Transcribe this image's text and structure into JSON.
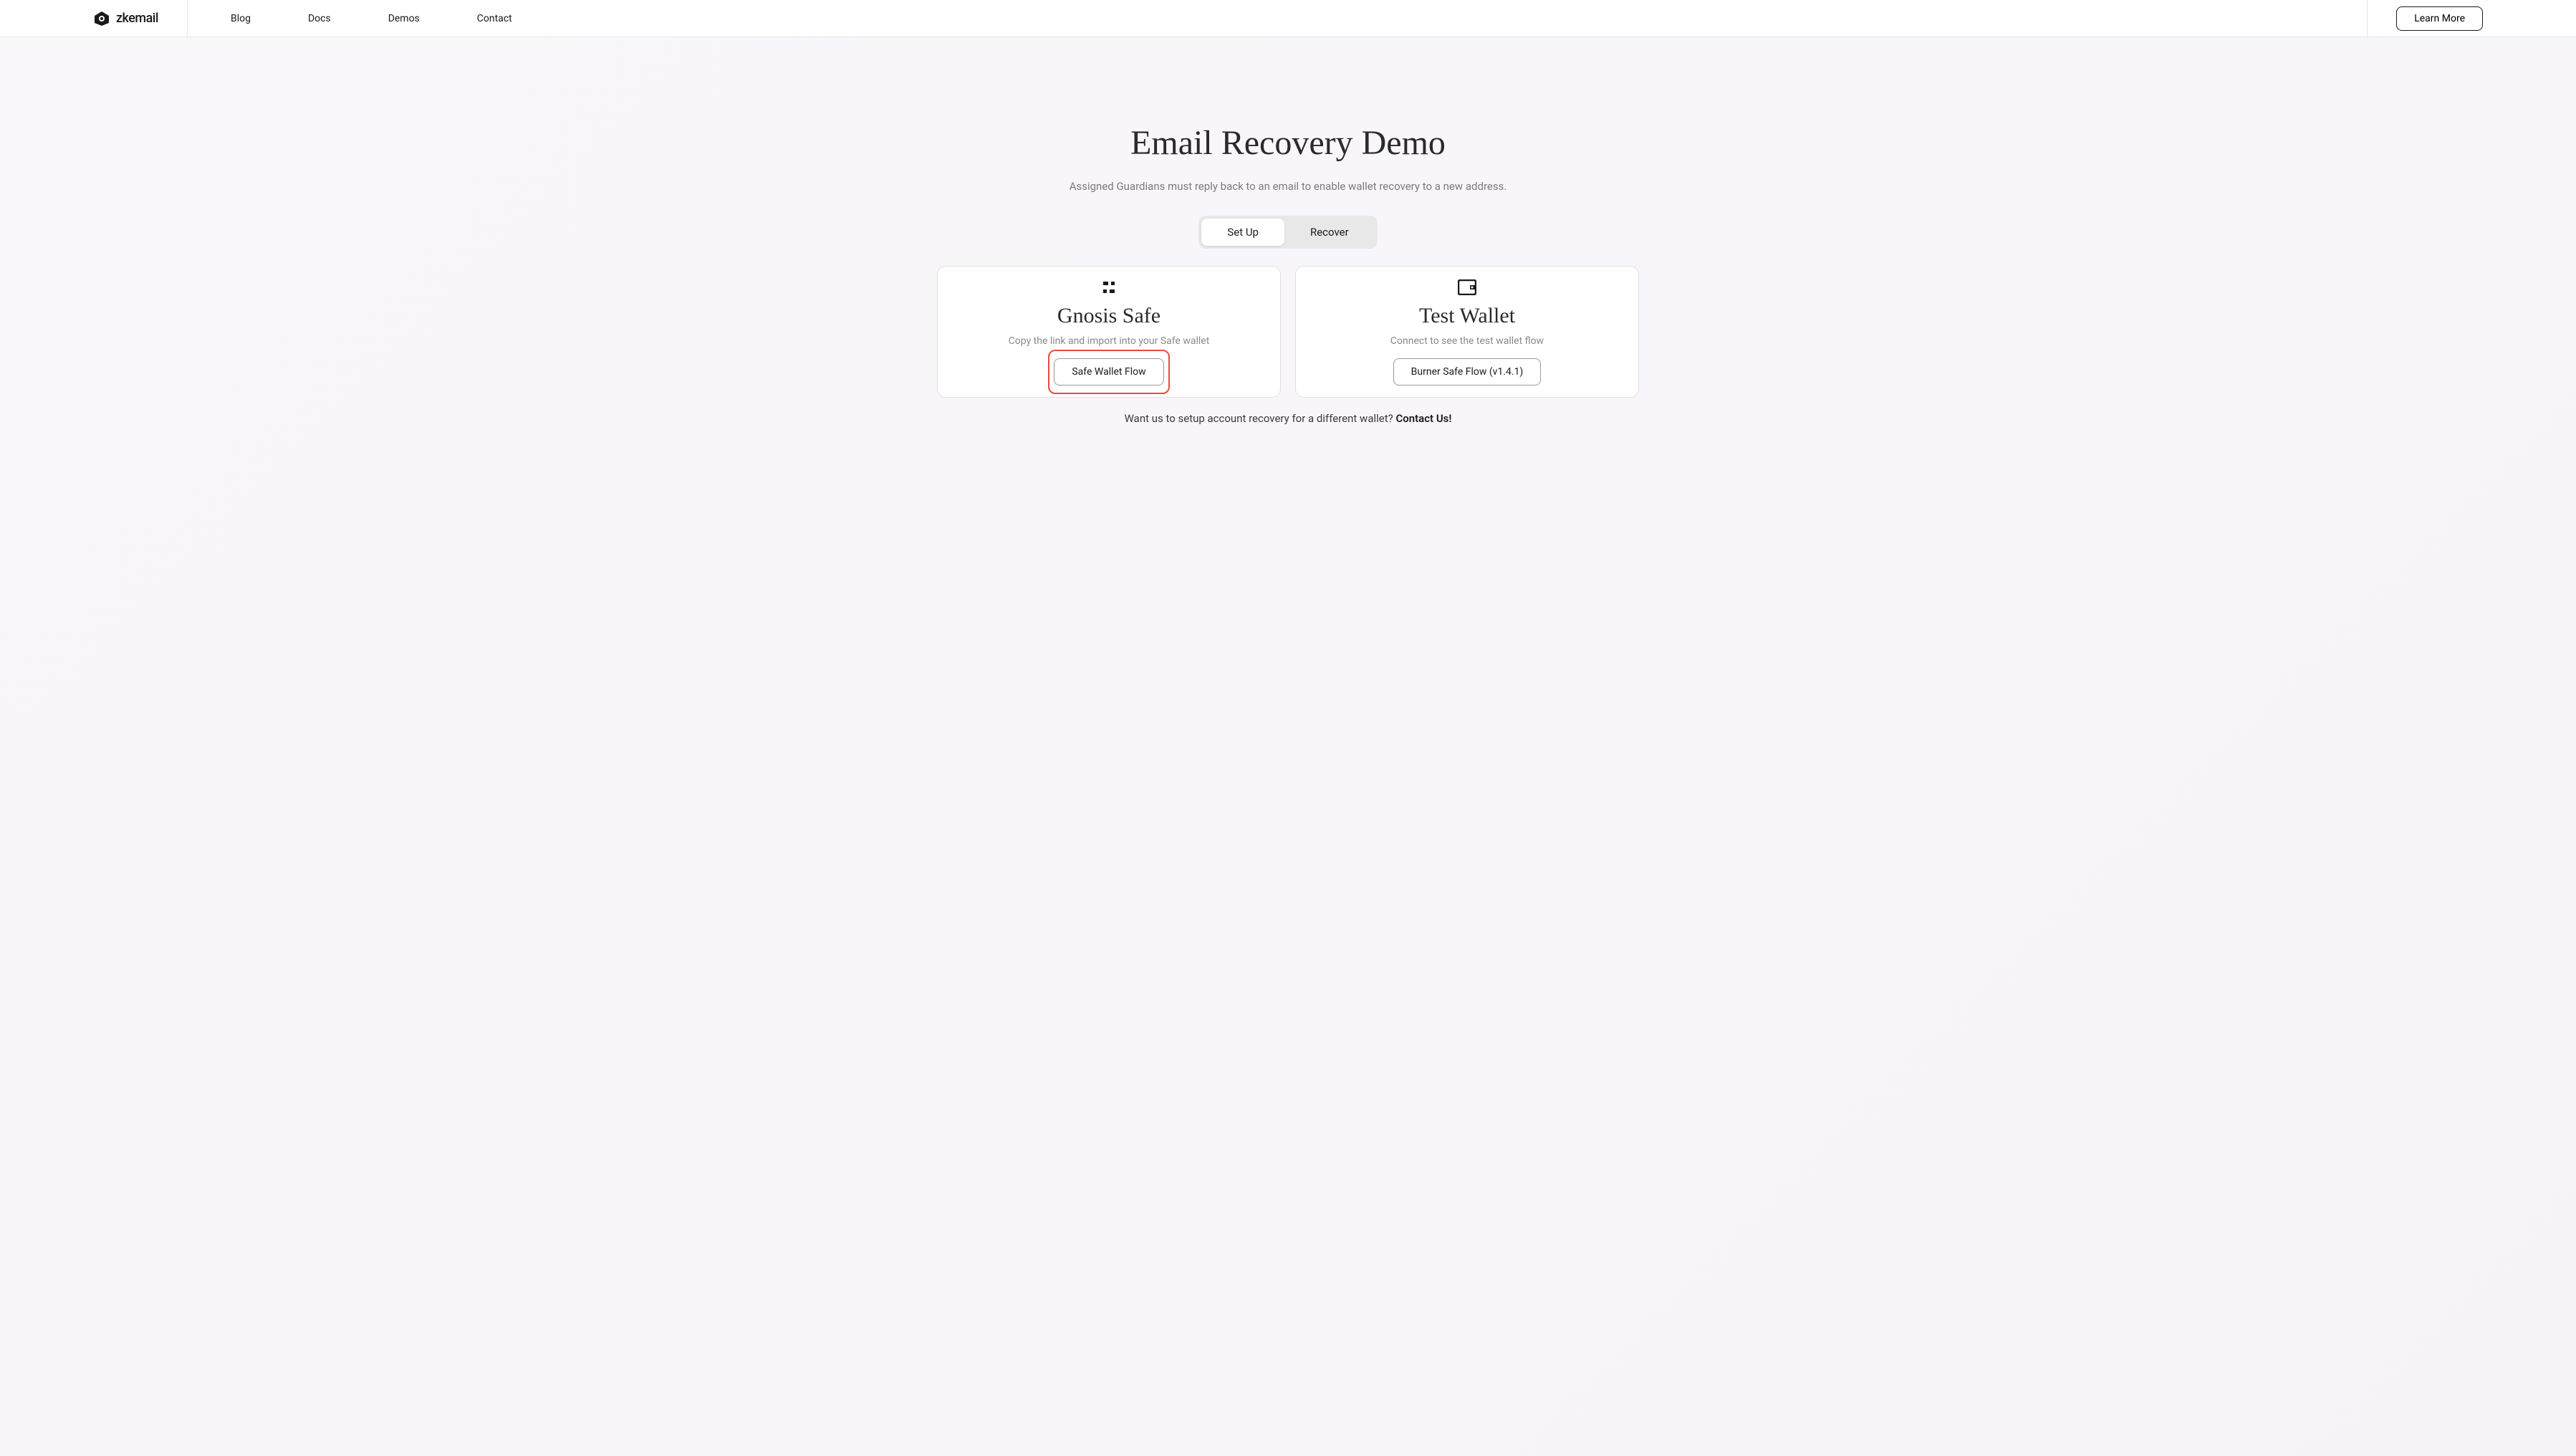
{
  "header": {
    "logo_text": "zkemail",
    "nav": {
      "blog": "Blog",
      "docs": "Docs",
      "demos": "Demos",
      "contact": "Contact"
    },
    "learn_more": "Learn More"
  },
  "main": {
    "title": "Email Recovery Demo",
    "subtitle": "Assigned Guardians must reply back to an email to enable wallet recovery to a new address.",
    "toggle": {
      "setup": "Set Up",
      "recover": "Recover"
    },
    "cards": {
      "gnosis": {
        "title": "Gnosis Safe",
        "subtitle": "Copy the link and import into your Safe wallet",
        "button": "Safe Wallet Flow"
      },
      "test": {
        "title": "Test Wallet",
        "subtitle": "Connect to see the test wallet flow",
        "button": "Burner Safe Flow (v1.4.1)"
      }
    },
    "footer": {
      "text": "Want us to setup account recovery for a different wallet? ",
      "link": "Contact Us!"
    }
  }
}
